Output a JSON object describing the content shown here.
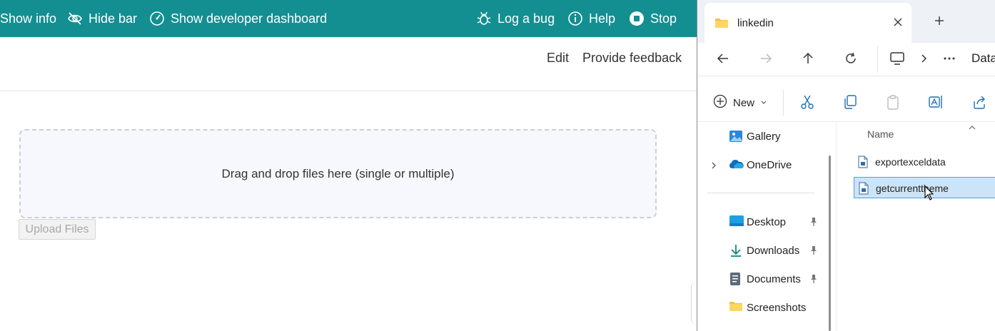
{
  "topbar": {
    "items": [
      {
        "label": "Show info",
        "icon": "info-icon"
      },
      {
        "label": "Hide bar",
        "icon": "eye-off-icon"
      },
      {
        "label": "Show developer dashboard",
        "icon": "dashboard-gauge-icon"
      },
      {
        "label": "Log a bug",
        "icon": "bug-icon"
      },
      {
        "label": "Help",
        "icon": "help-icon"
      },
      {
        "label": "Stop",
        "icon": "stop-icon"
      }
    ],
    "background": "#138f91"
  },
  "subbar": {
    "edit": "Edit",
    "feedback": "Provide feedback"
  },
  "upload": {
    "dropzone_text": "Drag and drop files here (single or multiple)",
    "button_label": "Upload Files"
  },
  "explorer": {
    "tab_title": "linkedin",
    "breadcrumb": "Data",
    "new_label": "New",
    "nav_pane": [
      {
        "label": "Gallery",
        "icon": "gallery-icon",
        "pinned": false
      },
      {
        "label": "OneDrive",
        "icon": "onedrive-cloud-icon",
        "pinned": false
      },
      {
        "label": "Desktop",
        "icon": "desktop-icon",
        "pinned": true
      },
      {
        "label": "Downloads",
        "icon": "download-icon",
        "pinned": true
      },
      {
        "label": "Documents",
        "icon": "documents-icon",
        "pinned": true
      },
      {
        "label": "Screenshots",
        "icon": "folder-icon",
        "pinned": false
      }
    ],
    "column_header": "Name",
    "files": [
      {
        "name": "exportexceldata",
        "selected": false
      },
      {
        "name": "getcurrenttheme",
        "selected": true
      }
    ],
    "selection_color": "#cce4f7"
  }
}
